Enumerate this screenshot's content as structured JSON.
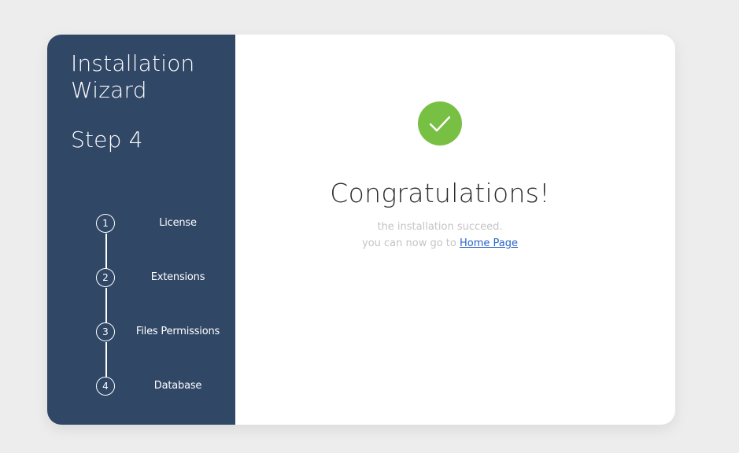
{
  "sidebar": {
    "title": "Installation Wizard",
    "current_step": "Step 4",
    "steps": [
      {
        "number": "1",
        "label": "License"
      },
      {
        "number": "2",
        "label": "Extensions"
      },
      {
        "number": "3",
        "label": "Files Permissions"
      },
      {
        "number": "4",
        "label": "Database"
      }
    ]
  },
  "main": {
    "status_icon": "check-icon",
    "heading": "Congratulations!",
    "line1": "the installation succeed.",
    "line2_prefix": "you can now go to",
    "link_label": "Home Page"
  },
  "colors": {
    "sidebar_bg": "#304766",
    "success": "#78c043",
    "link": "#2a63c8",
    "page_bg": "#ededed"
  }
}
